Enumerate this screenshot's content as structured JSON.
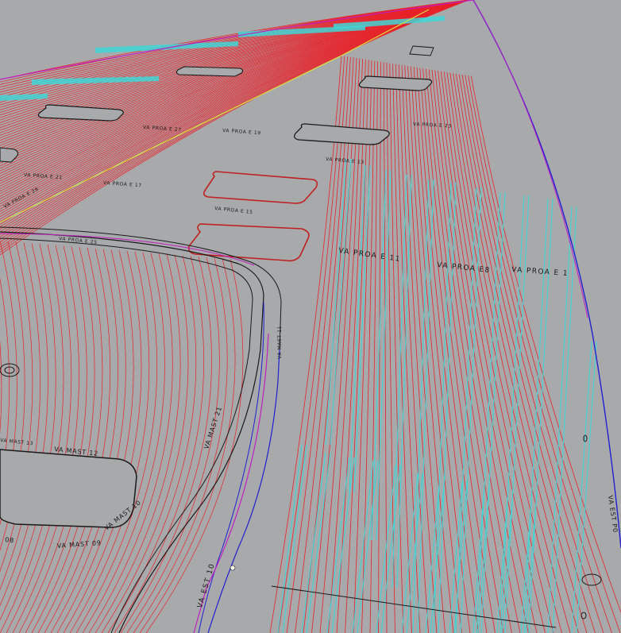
{
  "view": {
    "background": "#a8a9ab",
    "plank_color": "#e8222a",
    "highlight_color": "#3fd6d6",
    "outline_color": "#1a1a1a",
    "edge_color": "#c020c0",
    "guide_color": "#2020d0"
  },
  "labels": {
    "proa_e11": "VA PROA E 11",
    "proa_e8": "VA PROA E8",
    "proa_e1": "VA PROA E 1",
    "mast_11": "VA MAST 11",
    "mast_12": "VA MAST 12",
    "mast_10": "VA MAST 10",
    "mast_09": "VA MAST 09",
    "mast_08": "08",
    "mast_13": "VA MAST 13",
    "mast_21": "VA MAST 21",
    "est_10": "VA EST 10",
    "est_p0": "VA EST P0",
    "proa_e15": "VA PROA E 15",
    "proa_e13": "VA PROA E 13",
    "proa_e17": "VA PROA E 17",
    "proa_e19": "VA PROA E 19",
    "proa_e21": "VA PROA E 21",
    "proa_e23": "VA PROA E 23",
    "proa_e25": "VA PROA E 25",
    "proa_e27": "VA PROA E 27",
    "proa_e29": "VA PROA E 29"
  }
}
